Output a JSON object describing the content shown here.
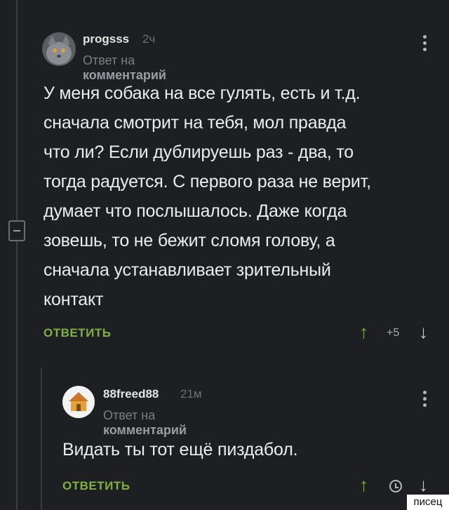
{
  "comments": [
    {
      "username": "progsss",
      "time": "2ч",
      "reply_prefix": "Ответ на",
      "reply_target": "комментарий",
      "text": "У меня собака на все гулять, есть и т.д. сначала смотрит на тебя, мол правда что ли? Если дублируешь раз - два, то тогда радуется. С первого раза не верит, думает что послышалось. Даже когда зовешь, то не бежит сломя голову, а сначала устанавливает зрительный контакт",
      "lines": [
        "У меня собака на все гулять, есть и т.д.",
        "сначала смотрит на тебя, мол правда",
        "что ли? Если дублируешь раз - два, то",
        "тогда радуется. С первого раза не верит,",
        "думает что послышалось. Даже когда",
        "зовешь, то не бежит сломя голову, а",
        "сначала устанавливает зрительный",
        "контакт"
      ],
      "reply_label": "ОТВЕТИТЬ",
      "score": "+5",
      "avatar_icon": "cat-avatar-icon"
    },
    {
      "username": "88freed88",
      "time": "21м",
      "reply_prefix": "Ответ на",
      "reply_target": "комментарий",
      "text": "Видать ты тот ещё пиздабол.",
      "reply_label": "ОТВЕТИТЬ",
      "avatar_icon": "house-avatar-icon"
    }
  ],
  "watermark": "писец",
  "colors": {
    "background": "#1e1f22",
    "accent": "#7fb043",
    "muted": "#6c6f74"
  }
}
